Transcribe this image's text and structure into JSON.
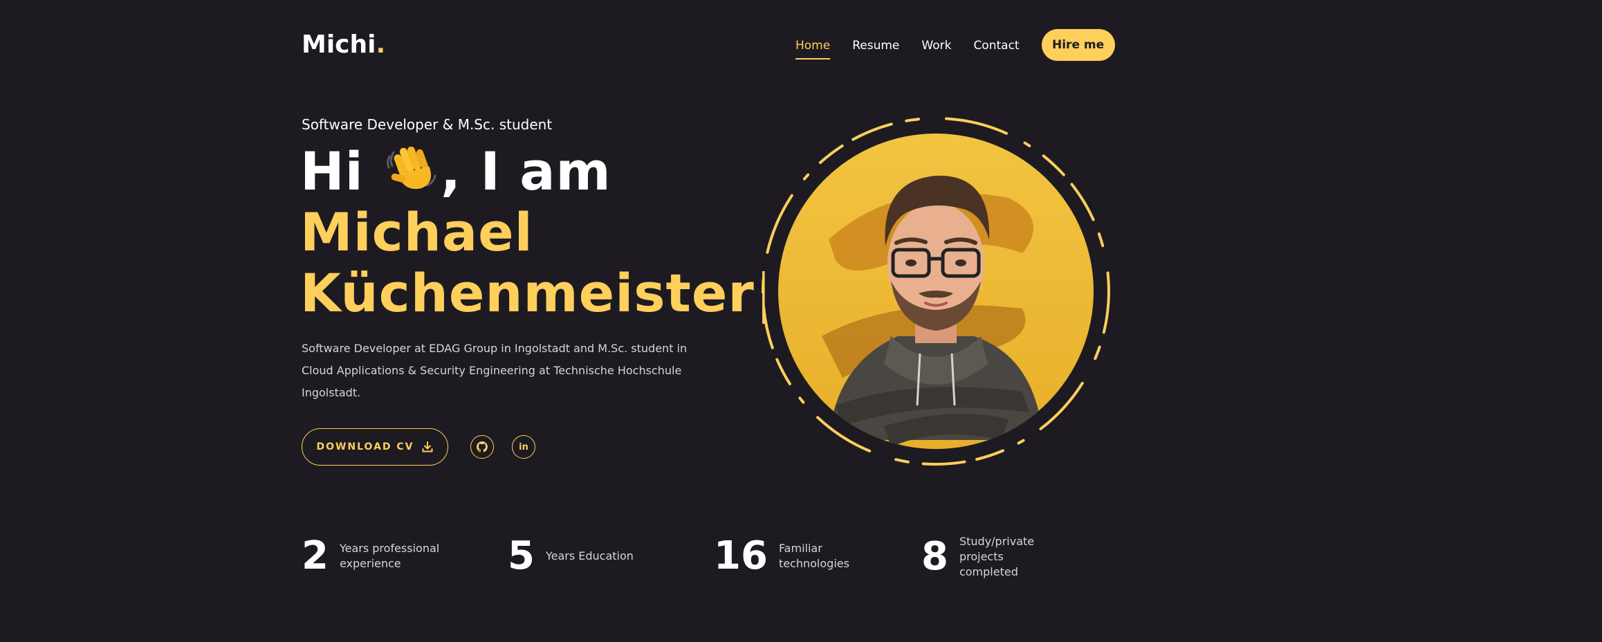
{
  "header": {
    "logo_text": "Michi",
    "logo_dot": ".",
    "nav": [
      {
        "label": "Home"
      },
      {
        "label": "Resume"
      },
      {
        "label": "Work"
      },
      {
        "label": "Contact"
      }
    ],
    "hire_label": "Hire me"
  },
  "hero": {
    "subtitle": "Software Developer & M.Sc. student",
    "greeting_before": "Hi",
    "greeting_after": ", I am",
    "wave_icon": "waving-hand-icon",
    "first_name": "Michael",
    "last_name": "Küchenmeister",
    "cursor": "|",
    "description": "Software Developer at EDAG Group in Ingolstadt and M.Sc. student in Cloud Applications & Security Engineering at Technische Hochschule Ingolstadt.",
    "download_label": "DOWNLOAD CV",
    "social": {
      "github_icon": "github-icon",
      "linkedin_text": "in"
    }
  },
  "stats": [
    {
      "number": "2",
      "label": "Years professional experience"
    },
    {
      "number": "5",
      "label": "Years Education"
    },
    {
      "number": "16",
      "label": "Familiar technologies"
    },
    {
      "number": "8",
      "label": "Study/private projects completed"
    }
  ],
  "colors": {
    "background": "#1d1b21",
    "accent": "#ffcf5c",
    "text": "#ffffff"
  }
}
